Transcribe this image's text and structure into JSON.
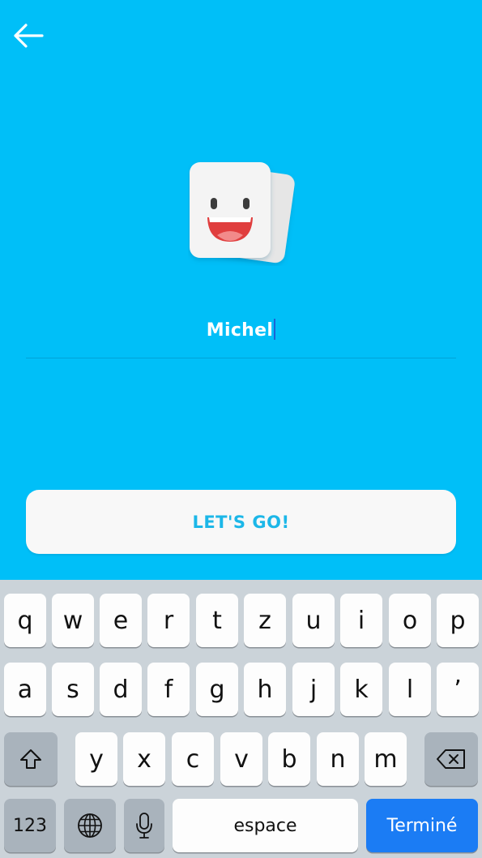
{
  "header": {
    "back_icon": "arrow-left-icon"
  },
  "mascot": {
    "icon": "smiling-card-mascot-icon"
  },
  "name_field": {
    "value": "Michel"
  },
  "cta": {
    "label": "LET'S GO!"
  },
  "keyboard": {
    "row1": [
      "q",
      "w",
      "e",
      "r",
      "t",
      "z",
      "u",
      "i",
      "o",
      "p"
    ],
    "row2": [
      "a",
      "s",
      "d",
      "f",
      "g",
      "h",
      "j",
      "k",
      "l",
      "’"
    ],
    "row3": [
      "y",
      "x",
      "c",
      "v",
      "b",
      "n",
      "m"
    ],
    "numbers_label": "123",
    "space_label": "espace",
    "done_label": "Terminé",
    "icons": {
      "shift": "shift-icon",
      "backspace": "backspace-icon",
      "globe": "globe-icon",
      "mic": "microphone-icon"
    }
  },
  "colors": {
    "background": "#00BFF8",
    "button": "#F8F8F8",
    "button_text": "#1CB7E8",
    "done_key": "#1B7CF4",
    "keyboard_bg": "#CBD3D9"
  }
}
